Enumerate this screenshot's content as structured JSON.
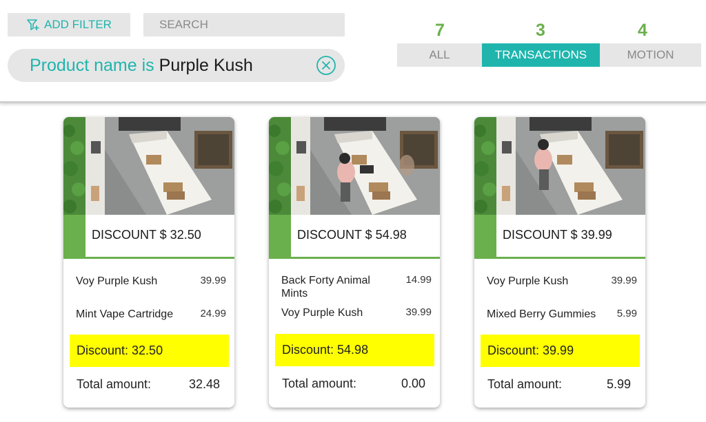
{
  "filter_bar": {
    "add_filter_label": "ADD FILTER",
    "search_placeholder": "SEARCH",
    "active_filter": {
      "field": "Product name is",
      "value": "Purple Kush"
    }
  },
  "tabs": [
    {
      "count": "7",
      "label": "ALL",
      "active": false
    },
    {
      "count": "3",
      "label": "TRANSACTIONS",
      "active": true
    },
    {
      "count": "4",
      "label": "MOTION",
      "active": false
    }
  ],
  "colors": {
    "accent_teal": "#1fb5ad",
    "accent_green": "#6ab04c",
    "highlight_yellow": "#ffff00"
  },
  "cards": [
    {
      "discount_title": "DISCOUNT $ 32.50",
      "items": [
        {
          "name": "Voy Purple Kush",
          "price": "39.99"
        },
        {
          "name": "Mint Vape Cartridge",
          "price": "24.99"
        }
      ],
      "discount_line": "Discount: 32.50",
      "total_label": "Total amount:",
      "total_value": "32.48"
    },
    {
      "discount_title": "DISCOUNT $ 54.98",
      "items": [
        {
          "name": "Back Forty Animal Mints",
          "price": "14.99"
        },
        {
          "name": "Voy Purple Kush",
          "price": "39.99"
        }
      ],
      "discount_line": "Discount: 54.98",
      "total_label": "Total amount:",
      "total_value": "0.00"
    },
    {
      "discount_title": "DISCOUNT $ 39.99",
      "items": [
        {
          "name": "Voy Purple Kush",
          "price": "39.99"
        },
        {
          "name": "Mixed Berry Gummies",
          "price": "5.99"
        }
      ],
      "discount_line": "Discount: 39.99",
      "total_label": "Total amount:",
      "total_value": "5.99"
    }
  ]
}
